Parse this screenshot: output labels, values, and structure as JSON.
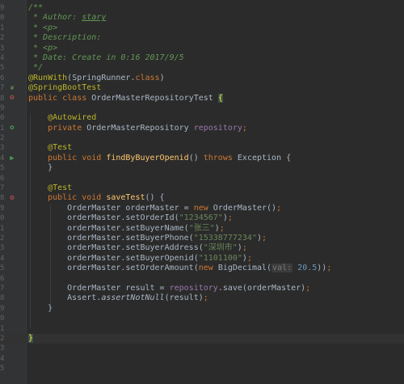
{
  "editor": {
    "lines": [
      {
        "parts": [
          {
            "t": "/**",
            "c": "doc"
          }
        ]
      },
      {
        "parts": [
          {
            "t": " * Author: ",
            "c": "doc"
          },
          {
            "t": "stary",
            "c": "doctag"
          }
        ]
      },
      {
        "parts": [
          {
            "t": " * <p>",
            "c": "doc"
          }
        ]
      },
      {
        "parts": [
          {
            "t": " * Description:",
            "c": "doc"
          }
        ]
      },
      {
        "parts": [
          {
            "t": " * <p>",
            "c": "doc"
          }
        ]
      },
      {
        "parts": [
          {
            "t": " * Date: Create in 0:16 2017/9/5",
            "c": "doc"
          }
        ]
      },
      {
        "parts": [
          {
            "t": " */",
            "c": "doc"
          }
        ]
      },
      {
        "parts": [
          {
            "t": "@RunWith",
            "c": "ann"
          },
          {
            "t": "(SpringRunner.",
            "c": ""
          },
          {
            "t": "class",
            "c": "kw"
          },
          {
            "t": ")",
            "c": ""
          }
        ]
      },
      {
        "icon": "spring-leaf-icon",
        "parts": [
          {
            "t": "@SpringBootTest",
            "c": "ann"
          }
        ]
      },
      {
        "icon": "run-bug-icon",
        "parts": [
          {
            "t": "public class ",
            "c": "kw"
          },
          {
            "t": "OrderMasterRepositoryTest ",
            "c": ""
          },
          {
            "t": "{",
            "c": "brace-hl"
          }
        ]
      },
      {
        "parts": [
          {
            "t": "",
            "c": ""
          }
        ]
      },
      {
        "parts": [
          {
            "t": "    @Autowired",
            "c": "ann"
          }
        ]
      },
      {
        "icon": "bean-icon",
        "parts": [
          {
            "t": "    private ",
            "c": "kw"
          },
          {
            "t": "OrderMasterRepository ",
            "c": ""
          },
          {
            "t": "repository",
            "c": "field"
          },
          {
            "t": ";",
            "c": "kw"
          }
        ]
      },
      {
        "parts": [
          {
            "t": "",
            "c": ""
          }
        ]
      },
      {
        "parts": [
          {
            "t": "    @Test",
            "c": "ann"
          }
        ]
      },
      {
        "icon": "run-icon",
        "parts": [
          {
            "t": "    public void ",
            "c": "kw"
          },
          {
            "t": "findByBuyerOpenid",
            "c": "meth"
          },
          {
            "t": "() ",
            "c": ""
          },
          {
            "t": "throws ",
            "c": "kw"
          },
          {
            "t": "Exception {",
            "c": ""
          }
        ]
      },
      {
        "parts": [
          {
            "t": "    }",
            "c": ""
          }
        ]
      },
      {
        "parts": [
          {
            "t": "",
            "c": ""
          }
        ]
      },
      {
        "parts": [
          {
            "t": "    @Test",
            "c": "ann"
          }
        ]
      },
      {
        "icon": "run-bug-icon",
        "parts": [
          {
            "t": "    public void ",
            "c": "kw"
          },
          {
            "t": "saveTest",
            "c": "meth"
          },
          {
            "t": "() {",
            "c": ""
          }
        ]
      },
      {
        "parts": [
          {
            "t": "        OrderMaster orderMaster = ",
            "c": ""
          },
          {
            "t": "new ",
            "c": "kw"
          },
          {
            "t": "OrderMaster()",
            "c": ""
          },
          {
            "t": ";",
            "c": "kw"
          }
        ]
      },
      {
        "parts": [
          {
            "t": "        orderMaster.setOrderId(",
            "c": ""
          },
          {
            "t": "\"1234567\"",
            "c": "str"
          },
          {
            "t": ")",
            "c": ""
          },
          {
            "t": ";",
            "c": "kw"
          }
        ]
      },
      {
        "parts": [
          {
            "t": "        orderMaster.setBuyerName(",
            "c": ""
          },
          {
            "t": "\"张三\"",
            "c": "str"
          },
          {
            "t": ")",
            "c": ""
          },
          {
            "t": ";",
            "c": "kw"
          }
        ]
      },
      {
        "parts": [
          {
            "t": "        orderMaster.setBuyerPhone(",
            "c": ""
          },
          {
            "t": "\"15338777234\"",
            "c": "str"
          },
          {
            "t": ")",
            "c": ""
          },
          {
            "t": ";",
            "c": "kw"
          }
        ]
      },
      {
        "parts": [
          {
            "t": "        orderMaster.setBuyerAddress(",
            "c": ""
          },
          {
            "t": "\"深圳市\"",
            "c": "str"
          },
          {
            "t": ")",
            "c": ""
          },
          {
            "t": ";",
            "c": "kw"
          }
        ]
      },
      {
        "parts": [
          {
            "t": "        orderMaster.setBuyerOpenid(",
            "c": ""
          },
          {
            "t": "\"1101100\"",
            "c": "str"
          },
          {
            "t": ")",
            "c": ""
          },
          {
            "t": ";",
            "c": "kw"
          }
        ]
      },
      {
        "parts": [
          {
            "t": "        orderMaster.setOrderAmount(",
            "c": ""
          },
          {
            "t": "new ",
            "c": "kw"
          },
          {
            "t": "BigDecimal(",
            "c": ""
          },
          {
            "t": "val:",
            "c": "hint"
          },
          {
            "t": " ",
            "c": ""
          },
          {
            "t": "20.5",
            "c": "num"
          },
          {
            "t": "))",
            "c": ""
          },
          {
            "t": ";",
            "c": "kw"
          }
        ]
      },
      {
        "parts": [
          {
            "t": "",
            "c": ""
          }
        ]
      },
      {
        "parts": [
          {
            "t": "        OrderMaster result = ",
            "c": ""
          },
          {
            "t": "repository",
            "c": "field"
          },
          {
            "t": ".save(orderMaster)",
            "c": ""
          },
          {
            "t": ";",
            "c": "kw"
          }
        ]
      },
      {
        "parts": [
          {
            "t": "        Assert.",
            "c": ""
          },
          {
            "t": "assertNotNull",
            "c": "static"
          },
          {
            "t": "(result)",
            "c": ""
          },
          {
            "t": ";",
            "c": "kw"
          }
        ]
      },
      {
        "parts": [
          {
            "t": "    }",
            "c": ""
          }
        ]
      },
      {
        "parts": [
          {
            "t": "",
            "c": ""
          }
        ]
      },
      {
        "parts": [
          {
            "t": "",
            "c": ""
          }
        ]
      },
      {
        "current": true,
        "parts": [
          {
            "t": "}",
            "c": "brace-hl"
          }
        ]
      },
      {
        "parts": [
          {
            "t": "",
            "c": ""
          }
        ]
      },
      {
        "parts": [
          {
            "t": "",
            "c": ""
          }
        ]
      },
      {
        "parts": [
          {
            "t": "",
            "c": ""
          }
        ]
      }
    ],
    "line_numbers": [
      "9",
      "0",
      "1",
      "2",
      "3",
      "4",
      "5",
      "6",
      "7",
      "8",
      "9",
      "0",
      "1",
      "2",
      "3",
      "4",
      "5",
      "6",
      "7",
      "8",
      "9",
      "0",
      "1",
      "2",
      "3",
      "4",
      "5",
      "6",
      "7",
      "8",
      "9",
      "0",
      "1",
      "2",
      "3",
      "4",
      "5",
      "6"
    ]
  },
  "icons": {
    "spring-leaf-icon": "❦",
    "run-bug-icon": "⚙",
    "bean-icon": "✿",
    "run-icon": "▶"
  }
}
